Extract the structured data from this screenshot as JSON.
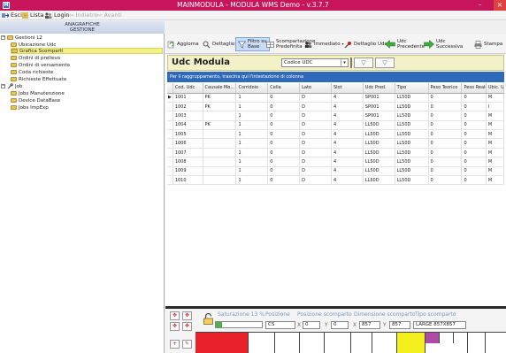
{
  "window": {
    "title": "MAINMODULA - MODULA WMS Demo - v.3.7.7",
    "app_icon_text": "M",
    "minimize": "–",
    "close": "×"
  },
  "menu": {
    "esci": "Esci",
    "lista": "Lista",
    "login": "Login",
    "indietro": "Indietro",
    "avanti": "Avanti"
  },
  "sidebar": {
    "header_line1": "ANAGRAFICHE",
    "header_line2": "GESTIONE",
    "root": "Gestioni L2",
    "items": [
      "Ubicazione Udc",
      "Grafica Scomparti",
      "Ordini di prelievo",
      "Ordini di versamento",
      "Coda richieste",
      "Richieste Effettuate"
    ],
    "job_root": "Job",
    "job_items": [
      "Jobs Manutenzione",
      "Device DataBase",
      "Jobs ImpExp"
    ],
    "selected_index": 1
  },
  "toolbar": {
    "aggiorna": "Aggiorna",
    "dettaglio": "Dettaglio",
    "filtro_line1": "Filtro su",
    "filtro_line2": "Base",
    "scomp_line1": "Scompartazione",
    "scomp_line2": "Predefinita",
    "immediato": "Immediato",
    "dettaglio_udc": "Dettaglio Udc",
    "prec_line1": "Udc",
    "prec_line2": "Precedente",
    "succ_line1": "Udc",
    "succ_line2": "Successiva",
    "stampa": "Stampa"
  },
  "panel": {
    "title": "Udc Modula",
    "combo_value": "Codice UDC",
    "group_hint": "Per il raggruppamento, trascina qui l'intestazione di colonna"
  },
  "table": {
    "columns": [
      "Cod. Udc",
      "Causale Mo...",
      "Corridoio",
      "Cella",
      "Lato",
      "Slot",
      "Udc Pred.",
      "Tipo",
      "Peso Teorico",
      "Peso Reale",
      "Ubic. Udc"
    ],
    "rows": [
      [
        "1001",
        "PK",
        "1",
        "0",
        "D",
        "4",
        "SP001",
        "LL50D",
        "0",
        "0",
        "M"
      ],
      [
        "1002",
        "PK",
        "1",
        "0",
        "D",
        "4",
        "SP001",
        "LL50D",
        "0",
        "0",
        "I"
      ],
      [
        "1003",
        "",
        "1",
        "0",
        "D",
        "4",
        "SP001",
        "LL50D",
        "0",
        "0",
        "M"
      ],
      [
        "1004",
        "PK",
        "1",
        "0",
        "D",
        "4",
        "LL50D",
        "LL50D",
        "0",
        "0",
        "M"
      ],
      [
        "1005",
        "",
        "1",
        "0",
        "D",
        "4",
        "LL50D",
        "LL50D",
        "0",
        "0",
        "M"
      ],
      [
        "1006",
        "",
        "1",
        "0",
        "D",
        "4",
        "LL50D",
        "LL50D",
        "0",
        "0",
        "M"
      ],
      [
        "1007",
        "",
        "1",
        "0",
        "D",
        "4",
        "LL50D",
        "LL50D",
        "0",
        "0",
        "M"
      ],
      [
        "1008",
        "",
        "1",
        "0",
        "D",
        "4",
        "LL50D",
        "LL50D",
        "0",
        "0",
        "M"
      ],
      [
        "1009",
        "",
        "1",
        "0",
        "D",
        "4",
        "LL50D",
        "LL50D",
        "0",
        "0",
        "M"
      ],
      [
        "1010",
        "",
        "1",
        "0",
        "D",
        "4",
        "LL50D",
        "LL50D",
        "0",
        "0",
        "M"
      ]
    ],
    "current_row_marker": "▶"
  },
  "bottom": {
    "saturazione": "Saturazione 13 %",
    "saturazione_percent": 13,
    "posizione_label": "Posizione",
    "posizione_value": "CS",
    "posizione_scomparto_label": "Posizione scomparto",
    "pos_x_label": "X",
    "pos_x": "0",
    "pos_y_label": "Y",
    "pos_y": "0",
    "dimensione_label": "Dimensione scomparto",
    "dim_x_label": "X",
    "dim_x": "857",
    "dim_y_label": "Y",
    "dim_y": "857",
    "tipo_label": "Tipo scomparto",
    "tipo_value": "LARGE 857X857"
  },
  "colors": {
    "titlebar": "#c8145a",
    "selected_tree": "#f3f08a",
    "group_bar": "#2f6ab8",
    "shelf_red": "#e8202a",
    "shelf_yellow": "#f4f01e",
    "shelf_purple": "#b04aa8"
  }
}
